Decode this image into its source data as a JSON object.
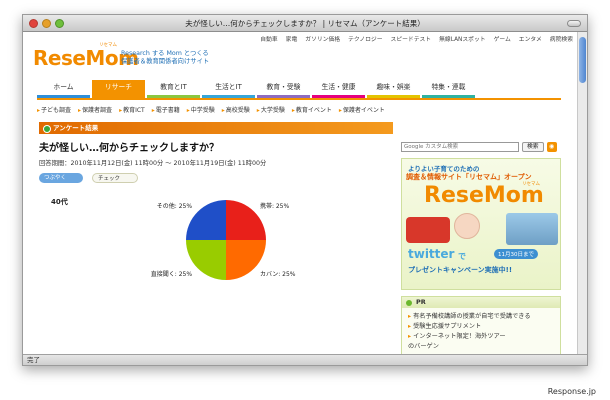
{
  "window": {
    "title": "夫が怪しい…何からチェックしますか？ | リセマム（アンケート結果）"
  },
  "top_links": [
    "自動車",
    "家電",
    "ガソリン価格",
    "テクノロジー",
    "スピードテスト",
    "無線LANスポット",
    "ゲーム",
    "エンタメ",
    "病院検索"
  ],
  "site": {
    "logo": "ReseMom",
    "logo_ruby": "リセマム",
    "tagline_1": "Research する Mom とつくる",
    "tagline_2": "保護者＆教育関係者向けサイト"
  },
  "main_nav": [
    {
      "label": "ホーム",
      "color": "#2f8fd8",
      "active": false
    },
    {
      "label": "リサーチ",
      "color": "#f39200",
      "active": true
    },
    {
      "label": "教育とIT",
      "color": "#8cc63f",
      "active": false
    },
    {
      "label": "生活とIT",
      "color": "#37a6d8",
      "active": false
    },
    {
      "label": "教育・受験",
      "color": "#8e6bbf",
      "active": false
    },
    {
      "label": "生活・健康",
      "color": "#e5007e",
      "active": false
    },
    {
      "label": "趣味・娯楽",
      "color": "#e3c400",
      "active": false
    },
    {
      "label": "特集・連載",
      "color": "#2fb3a1",
      "active": false
    }
  ],
  "sub_nav": [
    "子ども調査",
    "保護者調査",
    "教育ICT",
    "電子書籍",
    "中学受験",
    "高校受験",
    "大学受験",
    "教育イベント",
    "保護者イベント"
  ],
  "article": {
    "section": "アンケート結果",
    "title": "夫が怪しい…何からチェックしますか？",
    "period": "回答期間：2010年11月12日(金) 11時00分 ～ 2010年11月19日(金) 11時00分",
    "tweet_label": "つぶやく",
    "check_label": "チェック",
    "age_group": "40代"
  },
  "chart_data": {
    "type": "pie",
    "title": "",
    "slices": [
      {
        "label": "携帯: 25%",
        "value": 25,
        "color": "#e8201a"
      },
      {
        "label": "カバン: 25%",
        "value": 25,
        "color": "#ff6a00"
      },
      {
        "label": "直接聞く: 25%",
        "value": 25,
        "color": "#99cc00"
      },
      {
        "label": "その他: 25%",
        "value": 25,
        "color": "#1f4fc8"
      }
    ]
  },
  "sidebar": {
    "search_placeholder": "Google カスタム検索",
    "search_button": "検索",
    "banner": {
      "line1": "よりよい子育てのための",
      "line2": "調査＆情報サイト「リセマム」オープン",
      "logo": "ReseMom",
      "logo_ruby": "リセマム",
      "twitter": "twitter",
      "twitter_suffix": "で",
      "until": "11月30日まで",
      "campaign": "プレゼントキャンペーン実施中!!"
    },
    "pr": {
      "heading": "PR",
      "items": [
        "有名予備校講師の授業が自宅で受講できる",
        "受験生応援サプリメント",
        "インターネット限定！海外ツアー",
        "のバーゲン"
      ]
    }
  },
  "status": {
    "text": "完了"
  },
  "watermark": "Response.jp"
}
